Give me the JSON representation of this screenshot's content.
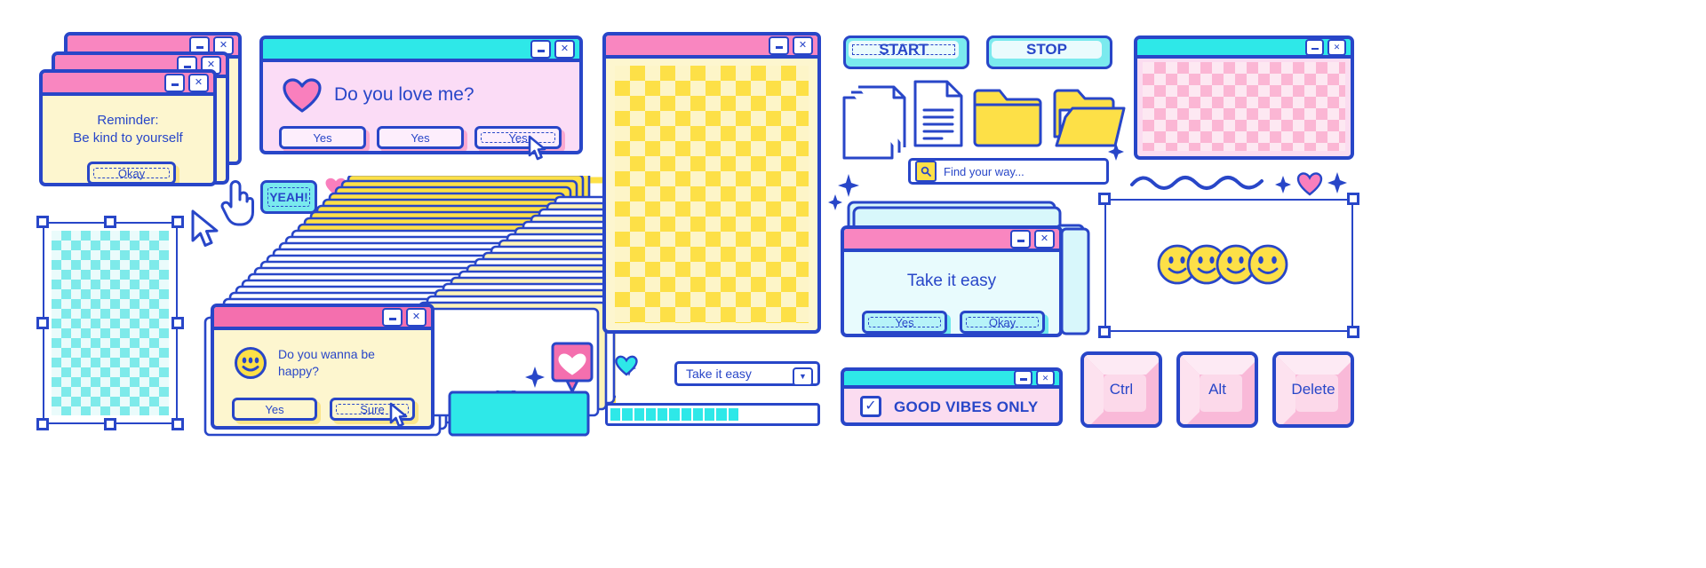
{
  "palette": {
    "blue": "#2846c8",
    "pink": "#f986c0",
    "pink_deep": "#f46fae",
    "cyan": "#2ee8e8",
    "cream": "#fdf6cf",
    "light_pink": "#fbdcf0",
    "yellow": "#fde047"
  },
  "reminder_window": {
    "title": "",
    "line1": "Reminder:",
    "line2": "Be kind to yourself",
    "okay_label": "Okay",
    "minimize": "–",
    "close": "✕"
  },
  "love_window": {
    "heading": "Do you love me?",
    "heart_icon": "heart-icon",
    "buttons": [
      "Yes",
      "Yes",
      "Yes"
    ],
    "minimize": "–",
    "close": "✕"
  },
  "yeah_button": {
    "label": "YEAH!"
  },
  "happy_window": {
    "line1": "Do you wanna be",
    "line2": "happy?",
    "smiley_icon": "smiley-icon",
    "buttons": [
      "Yes",
      "Sure"
    ],
    "minimize": "–",
    "close": "✕"
  },
  "yellow_checker_window": {
    "minimize": "–",
    "close": "✕",
    "pattern": "yellow-checkerboard"
  },
  "pink_checker_window": {
    "minimize": "–",
    "close": "✕",
    "pattern": "pink-checkerboard"
  },
  "cyan_checker_selection": {
    "pattern": "cyan-checkerboard"
  },
  "start_button": {
    "label": "START"
  },
  "stop_button": {
    "label": "STOP"
  },
  "file_icons": [
    {
      "name": "documents-stack-icon"
    },
    {
      "name": "document-text-icon"
    },
    {
      "name": "folder-closed-icon"
    },
    {
      "name": "folder-open-icon"
    }
  ],
  "search": {
    "placeholder": "Find your way...",
    "value": "Find your way...",
    "icon": "search-icon"
  },
  "take_it_easy_window": {
    "heading": "Take it easy",
    "buttons": [
      "Yes",
      "Okay"
    ],
    "minimize": "–",
    "close": "✕"
  },
  "good_vibes_window": {
    "label": "GOOD VIBES ONLY",
    "checked": true,
    "check_glyph": "✓",
    "minimize": "–",
    "close": "✕"
  },
  "dropdown": {
    "value": "Take it easy",
    "arrow": "▼"
  },
  "progress_bar": {
    "segments_total": 18,
    "segments_filled": 11,
    "percent": 61
  },
  "smileys": {
    "count": 4,
    "icon": "smiley-face-icon"
  },
  "keys": [
    {
      "label": "Ctrl"
    },
    {
      "label": "Alt"
    },
    {
      "label": "Delete"
    }
  ],
  "decorations": {
    "cursor_arrow": "cursor-arrow-icon",
    "pointer_hand": "pointer-hand-icon",
    "squiggle": "squiggle-line",
    "hearts": [
      "heart-pink-small",
      "heart-cyan-small",
      "heart-bubble-white"
    ],
    "sparkles": 6
  }
}
